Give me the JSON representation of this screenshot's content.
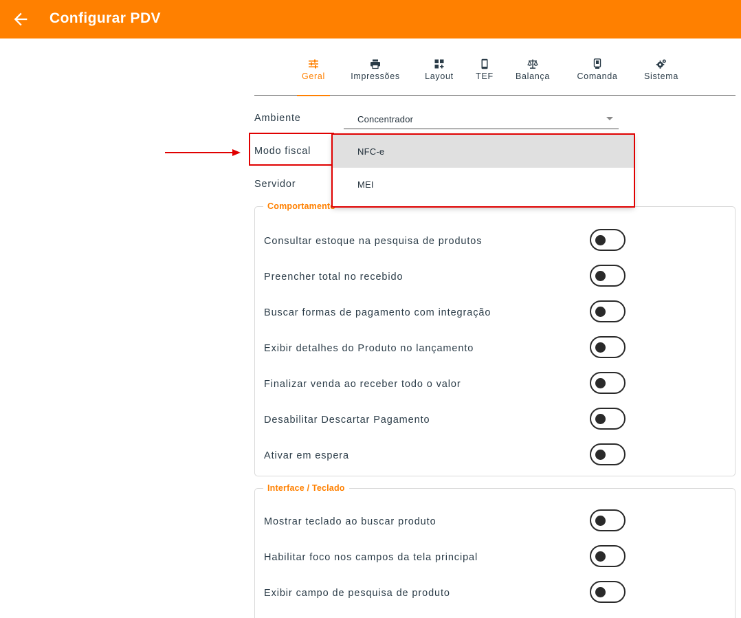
{
  "app": {
    "title": "Configurar PDV",
    "back_icon": "arrow-left-icon",
    "header_color": "#ff8000"
  },
  "tabs": [
    {
      "label": "Geral",
      "icon": "tune-sliders-icon",
      "active": true
    },
    {
      "label": "Impressões",
      "icon": "printer-icon",
      "active": false
    },
    {
      "label": "Layout",
      "icon": "grid-add-icon",
      "active": false
    },
    {
      "label": "TEF",
      "icon": "mobile-phone-icon",
      "active": false
    },
    {
      "label": "Balança",
      "icon": "scale-icon",
      "active": false
    },
    {
      "label": "Comanda",
      "icon": "tablet-touch-icon",
      "active": false
    },
    {
      "label": "Sistema",
      "icon": "gears-icon",
      "active": false
    }
  ],
  "form": {
    "ambiente_label": "Ambiente",
    "ambiente_value": "Concentrador",
    "modo_fiscal_label": "Modo fiscal",
    "servidor_label": "Servidor"
  },
  "dropdown": {
    "options": [
      {
        "label": "NFC-e",
        "selected": true
      },
      {
        "label": "MEI",
        "selected": false
      }
    ]
  },
  "sections": [
    {
      "title": "Comportamento",
      "items": [
        {
          "label": "Consultar estoque na pesquisa de produtos",
          "on": false
        },
        {
          "label": "Preencher total no recebido",
          "on": false
        },
        {
          "label": "Buscar formas de pagamento com integração",
          "on": false
        },
        {
          "label": "Exibir detalhes do Produto no lançamento",
          "on": false
        },
        {
          "label": "Finalizar venda ao receber todo o valor",
          "on": false
        },
        {
          "label": "Desabilitar Descartar Pagamento",
          "on": false
        },
        {
          "label": "Ativar em espera",
          "on": false
        }
      ]
    },
    {
      "title": "Interface / Teclado",
      "items": [
        {
          "label": "Mostrar teclado ao buscar produto",
          "on": false
        },
        {
          "label": "Habilitar foco nos campos da tela principal",
          "on": false
        },
        {
          "label": "Exibir campo de pesquisa de produto",
          "on": false
        }
      ]
    }
  ],
  "colors": {
    "accent": "#ff8000",
    "annotation": "#e00000",
    "text": "#2a3b47"
  }
}
